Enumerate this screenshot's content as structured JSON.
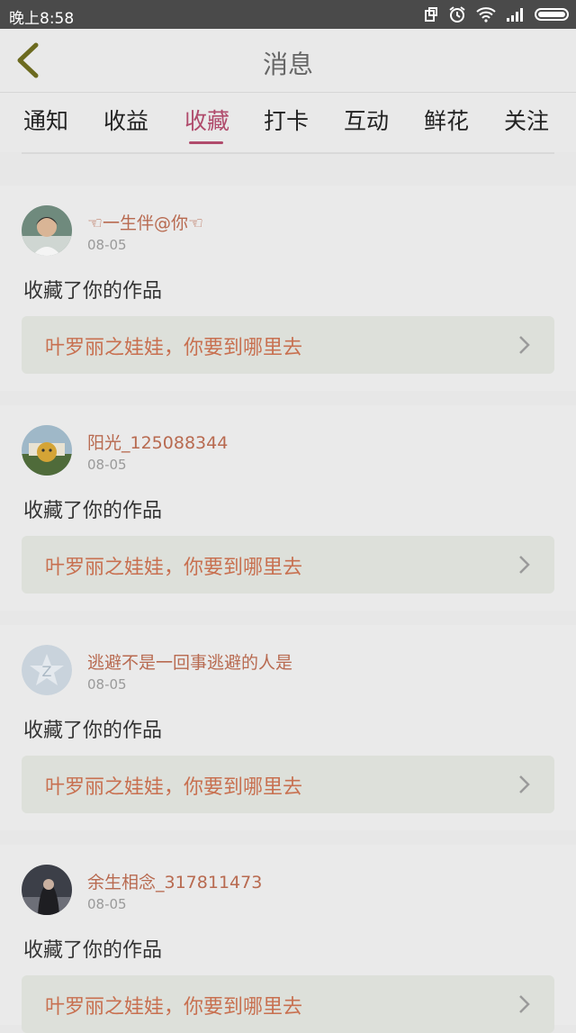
{
  "status_bar": {
    "time": "晚上8:58",
    "icons": [
      "rotation-icon",
      "alarm-icon",
      "wifi-icon",
      "signal-icon",
      "battery-icon"
    ]
  },
  "header": {
    "title": "消息"
  },
  "tabs": [
    {
      "label": "通知"
    },
    {
      "label": "收益"
    },
    {
      "label": "收藏",
      "active": true
    },
    {
      "label": "打卡"
    },
    {
      "label": "互动"
    },
    {
      "label": "鲜花"
    },
    {
      "label": "关注"
    }
  ],
  "messages": [
    {
      "username": "☜一生伴@你☜",
      "date": "08-05",
      "action": "收藏了你的作品",
      "work_title": "叶罗丽之娃娃，你要到哪里去"
    },
    {
      "username": "阳光_125088344",
      "date": "08-05",
      "action": "收藏了你的作品",
      "work_title": "叶罗丽之娃娃，你要到哪里去"
    },
    {
      "username": "逃避不是一回事逃避的人是",
      "date": "08-05",
      "action": "收藏了你的作品",
      "work_title": "叶罗丽之娃娃，你要到哪里去"
    },
    {
      "username": "余生相念_317811473",
      "date": "08-05",
      "action": "收藏了你的作品",
      "work_title": "叶罗丽之娃娃，你要到哪里去"
    }
  ],
  "colors": {
    "accent": "#b04b6c",
    "username": "#b86a50",
    "work_title": "#c87050"
  }
}
